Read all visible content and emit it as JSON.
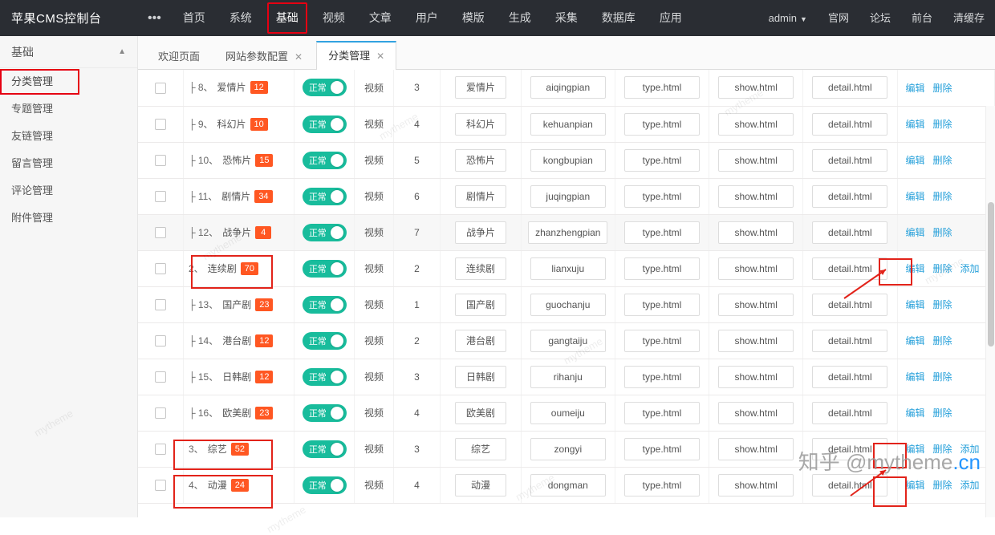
{
  "topbar": {
    "brand": "苹果CMS控制台",
    "nav": [
      {
        "label": "•••",
        "active": false,
        "boxed": false
      },
      {
        "label": "首页",
        "active": false,
        "boxed": false
      },
      {
        "label": "系统",
        "active": false,
        "boxed": false
      },
      {
        "label": "基础",
        "active": true,
        "boxed": true
      },
      {
        "label": "视频",
        "active": false,
        "boxed": false
      },
      {
        "label": "文章",
        "active": false,
        "boxed": false
      },
      {
        "label": "用户",
        "active": false,
        "boxed": false
      },
      {
        "label": "模版",
        "active": false,
        "boxed": false
      },
      {
        "label": "生成",
        "active": false,
        "boxed": false
      },
      {
        "label": "采集",
        "active": false,
        "boxed": false
      },
      {
        "label": "数据库",
        "active": false,
        "boxed": false
      },
      {
        "label": "应用",
        "active": false,
        "boxed": false
      }
    ],
    "right": [
      {
        "label": "admin",
        "caret": true
      },
      {
        "label": "官网",
        "caret": false
      },
      {
        "label": "论坛",
        "caret": false
      },
      {
        "label": "前台",
        "caret": false
      },
      {
        "label": "清缓存",
        "caret": false
      }
    ]
  },
  "sidebar": {
    "title": "基础",
    "items": [
      {
        "label": "分类管理",
        "selected": true
      },
      {
        "label": "专题管理",
        "selected": false
      },
      {
        "label": "友链管理",
        "selected": false
      },
      {
        "label": "留言管理",
        "selected": false
      },
      {
        "label": "评论管理",
        "selected": false
      },
      {
        "label": "附件管理",
        "selected": false
      }
    ]
  },
  "tabs": [
    {
      "label": "欢迎页面",
      "closable": false,
      "active": false
    },
    {
      "label": "网站参数配置",
      "closable": true,
      "active": false
    },
    {
      "label": "分类管理",
      "closable": true,
      "active": true
    }
  ],
  "table": {
    "status_label": "正常",
    "ops": {
      "edit": "编辑",
      "delete": "删除",
      "add": "添加"
    },
    "rows": [
      {
        "index": "├ 8、",
        "name": "爱情片",
        "count": "12",
        "type": "视频",
        "sort": "3",
        "title": "爱情片",
        "en": "aiqingpian",
        "tpl": "type.html",
        "show": "show.html",
        "detail": "detail.html",
        "ops": [
          "编辑",
          "删除"
        ],
        "shade": false,
        "highlight": false
      },
      {
        "index": "├ 9、",
        "name": "科幻片",
        "count": "10",
        "type": "视频",
        "sort": "4",
        "title": "科幻片",
        "en": "kehuanpian",
        "tpl": "type.html",
        "show": "show.html",
        "detail": "detail.html",
        "ops": [
          "编辑",
          "删除"
        ],
        "shade": false,
        "highlight": false
      },
      {
        "index": "├ 10、",
        "name": "恐怖片",
        "count": "15",
        "type": "视频",
        "sort": "5",
        "title": "恐怖片",
        "en": "kongbupian",
        "tpl": "type.html",
        "show": "show.html",
        "detail": "detail.html",
        "ops": [
          "编辑",
          "删除"
        ],
        "shade": false,
        "highlight": false
      },
      {
        "index": "├ 11、",
        "name": "剧情片",
        "count": "34",
        "type": "视频",
        "sort": "6",
        "title": "剧情片",
        "en": "juqingpian",
        "tpl": "type.html",
        "show": "show.html",
        "detail": "detail.html",
        "ops": [
          "编辑",
          "删除"
        ],
        "shade": false,
        "highlight": false
      },
      {
        "index": "├ 12、",
        "name": "战争片",
        "count": "4",
        "type": "视频",
        "sort": "7",
        "title": "战争片",
        "en": "zhanzhengpian",
        "tpl": "type.html",
        "show": "show.html",
        "detail": "detail.html",
        "ops": [
          "编辑",
          "删除"
        ],
        "shade": true,
        "highlight": false
      },
      {
        "index": "2、",
        "name": "连续剧",
        "count": "70",
        "type": "视频",
        "sort": "2",
        "title": "连续剧",
        "en": "lianxuju",
        "tpl": "type.html",
        "show": "show.html",
        "detail": "detail.html",
        "ops": [
          "编辑",
          "删除",
          "添加"
        ],
        "shade": false,
        "highlight": true
      },
      {
        "index": "├ 13、",
        "name": "国产剧",
        "count": "23",
        "type": "视频",
        "sort": "1",
        "title": "国产剧",
        "en": "guochanju",
        "tpl": "type.html",
        "show": "show.html",
        "detail": "detail.html",
        "ops": [
          "编辑",
          "删除"
        ],
        "shade": false,
        "highlight": false
      },
      {
        "index": "├ 14、",
        "name": "港台剧",
        "count": "12",
        "type": "视频",
        "sort": "2",
        "title": "港台剧",
        "en": "gangtaiju",
        "tpl": "type.html",
        "show": "show.html",
        "detail": "detail.html",
        "ops": [
          "编辑",
          "删除"
        ],
        "shade": false,
        "highlight": false
      },
      {
        "index": "├ 15、",
        "name": "日韩剧",
        "count": "12",
        "type": "视频",
        "sort": "3",
        "title": "日韩剧",
        "en": "rihanju",
        "tpl": "type.html",
        "show": "show.html",
        "detail": "detail.html",
        "ops": [
          "编辑",
          "删除"
        ],
        "shade": false,
        "highlight": false
      },
      {
        "index": "├ 16、",
        "name": "欧美剧",
        "count": "23",
        "type": "视频",
        "sort": "4",
        "title": "欧美剧",
        "en": "oumeiju",
        "tpl": "type.html",
        "show": "show.html",
        "detail": "detail.html",
        "ops": [
          "编辑",
          "删除"
        ],
        "shade": false,
        "highlight": false
      },
      {
        "index": "3、",
        "name": "综艺",
        "count": "52",
        "type": "视频",
        "sort": "3",
        "title": "综艺",
        "en": "zongyi",
        "tpl": "type.html",
        "show": "show.html",
        "detail": "detail.html",
        "ops": [
          "编辑",
          "删除",
          "添加"
        ],
        "shade": false,
        "highlight": true
      },
      {
        "index": "4、",
        "name": "动漫",
        "count": "24",
        "type": "视频",
        "sort": "4",
        "title": "动漫",
        "en": "dongman",
        "tpl": "type.html",
        "show": "show.html",
        "detail": "detail.html",
        "ops": [
          "编辑",
          "删除",
          "添加"
        ],
        "shade": false,
        "highlight": true
      }
    ]
  },
  "watermark": {
    "tiles": [
      "mytheme",
      "mytheme",
      "mytheme",
      "mytheme",
      "mytheme",
      "mytheme",
      "mytheme",
      "mytheme"
    ],
    "zhihu": "知乎 @mytheme",
    "zhihu_suffix": ".cn"
  },
  "colors": {
    "accent_red": "#e2231a",
    "badge": "#ff5722",
    "toggle_green": "#18bc9c",
    "link_blue": "#26a0da",
    "topbar_bg": "#2a2d33"
  }
}
